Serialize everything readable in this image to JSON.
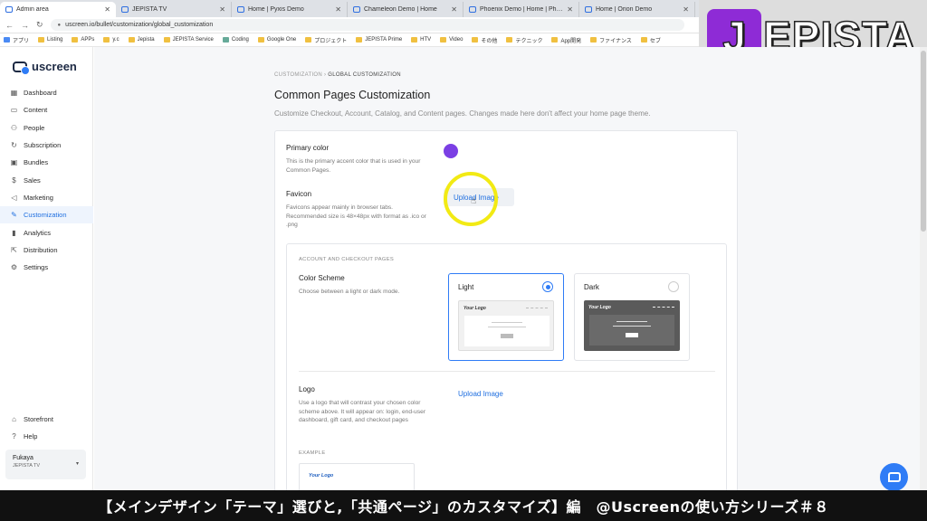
{
  "browser": {
    "tabs": [
      {
        "title": "Admin area",
        "active": true
      },
      {
        "title": "JEPISTA TV"
      },
      {
        "title": "Home | Pyxis Demo"
      },
      {
        "title": "Chameleon Demo | Home"
      },
      {
        "title": "Phoenix Demo | Home | Phoenix"
      },
      {
        "title": "Home | Orion Demo"
      }
    ],
    "url": "uscreen.io/bullet/customization/global_customization",
    "bookmarks": [
      "アプリ",
      "Listing",
      "APPs",
      "y.c",
      "Jepista",
      "JEPISTA Service",
      "Coding",
      "Google One",
      "プロジェクト",
      "JEPISTA Prime",
      "HTV",
      "Video",
      "その他",
      "テクニック",
      "App開発",
      "ファイナンス",
      "セブ"
    ]
  },
  "overlay_logo": {
    "first": "J",
    "rest": "EPISTA"
  },
  "sidebar": {
    "brand": "uscreen",
    "items": [
      {
        "label": "Dashboard",
        "icon": "grid-icon"
      },
      {
        "label": "Content",
        "icon": "folder-icon"
      },
      {
        "label": "People",
        "icon": "people-icon"
      },
      {
        "label": "Subscription",
        "icon": "refresh-icon"
      },
      {
        "label": "Bundles",
        "icon": "box-icon"
      },
      {
        "label": "Sales",
        "icon": "dollar-icon"
      },
      {
        "label": "Marketing",
        "icon": "megaphone-icon"
      },
      {
        "label": "Customization",
        "icon": "brush-icon",
        "active": true
      },
      {
        "label": "Analytics",
        "icon": "chart-icon"
      },
      {
        "label": "Distribution",
        "icon": "share-icon"
      },
      {
        "label": "Settings",
        "icon": "gear-icon"
      }
    ],
    "bottom": [
      {
        "label": "Storefront",
        "icon": "storefront-icon"
      },
      {
        "label": "Help",
        "icon": "help-icon"
      }
    ],
    "account": {
      "name": "Fukaya",
      "org": "JEPISTA TV"
    }
  },
  "main": {
    "breadcrumb": {
      "parent": "CUSTOMIZATION",
      "sep": "›",
      "current": "GLOBAL CUSTOMIZATION"
    },
    "title": "Common Pages Customization",
    "subtitle": "Customize Checkout, Account, Catalog, and Content pages. Changes made here don't affect your home page theme.",
    "primary_color": {
      "label": "Primary color",
      "help": "This is the primary accent color that is used in your Common Pages.",
      "value": "#7b3fe4"
    },
    "favicon": {
      "label": "Favicon",
      "help": "Favicons appear mainly in browser tabs. Recommended size is 48×48px with format as .ico or .png",
      "button": "Upload Image"
    },
    "account_section": {
      "heading": "ACCOUNT AND CHECKOUT PAGES",
      "color_scheme": {
        "label": "Color Scheme",
        "help": "Choose between a light or dark mode.",
        "options": [
          {
            "name": "Light",
            "selected": true,
            "preview_logo": "Your Logo"
          },
          {
            "name": "Dark",
            "selected": false,
            "preview_logo": "Your Logo"
          }
        ]
      },
      "logo": {
        "label": "Logo",
        "help": "Use a logo that will contrast your chosen color scheme above. It will appear on: login, end-user dashboard, gift card, and checkout pages",
        "button": "Upload Image",
        "example_label": "EXAMPLE",
        "example_logo": "Your Logo"
      }
    }
  },
  "caption": "【メインデザイン「テーマ」選びと,「共通ページ」のカスタマイズ】編　@Uscreenの使い方シリーズ＃８"
}
